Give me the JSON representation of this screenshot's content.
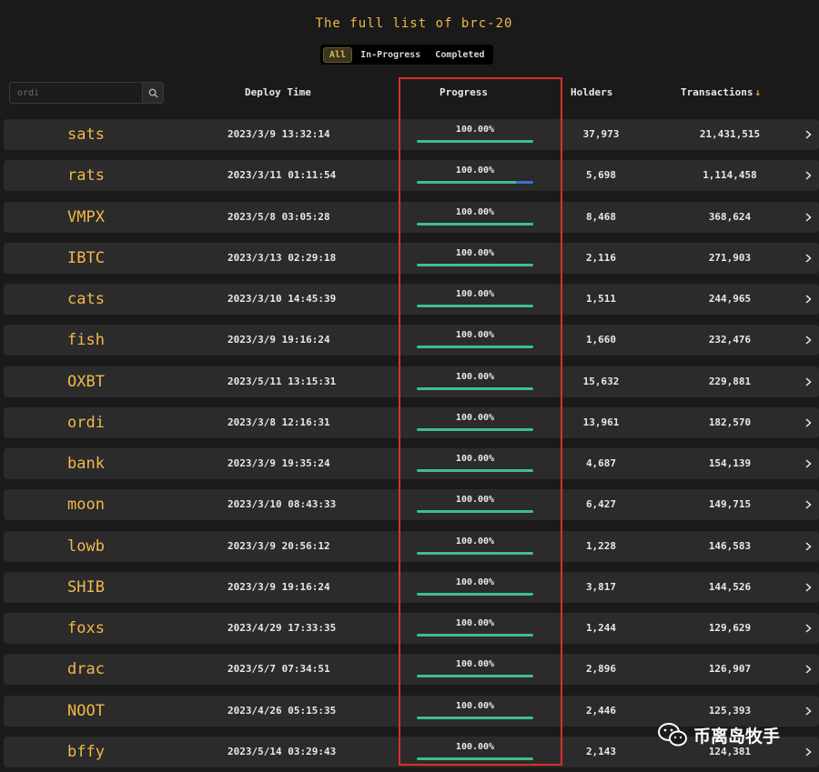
{
  "title": "The full list of brc-20",
  "tabs": [
    {
      "label": "All",
      "active": true
    },
    {
      "label": "In-Progress",
      "active": false
    },
    {
      "label": "Completed",
      "active": false
    }
  ],
  "search": {
    "placeholder": "ordi",
    "icon": "search-icon"
  },
  "columns": {
    "deploy_time": "Deploy Time",
    "progress": "Progress",
    "holders": "Holders",
    "transactions": "Transactions",
    "sort_indicator": "↓"
  },
  "colors": {
    "accent": "#f2b84b",
    "progress_fill": "#3fbf8a",
    "progress_track": "#3a6ed8",
    "highlight": "#d9302a"
  },
  "rows": [
    {
      "ticker": "sats",
      "deploy_time": "2023/3/9 13:32:14",
      "progress_label": "100.00%",
      "progress_fraction": 1.0,
      "holders": "37,973",
      "transactions": "21,431,515"
    },
    {
      "ticker": "rats",
      "deploy_time": "2023/3/11 01:11:54",
      "progress_label": "100.00%",
      "progress_fraction": 0.85,
      "holders": "5,698",
      "transactions": "1,114,458"
    },
    {
      "ticker": "VMPX",
      "deploy_time": "2023/5/8 03:05:28",
      "progress_label": "100.00%",
      "progress_fraction": 1.0,
      "holders": "8,468",
      "transactions": "368,624"
    },
    {
      "ticker": "IBTC",
      "deploy_time": "2023/3/13 02:29:18",
      "progress_label": "100.00%",
      "progress_fraction": 1.0,
      "holders": "2,116",
      "transactions": "271,903"
    },
    {
      "ticker": "cats",
      "deploy_time": "2023/3/10 14:45:39",
      "progress_label": "100.00%",
      "progress_fraction": 1.0,
      "holders": "1,511",
      "transactions": "244,965"
    },
    {
      "ticker": "fish",
      "deploy_time": "2023/3/9 19:16:24",
      "progress_label": "100.00%",
      "progress_fraction": 1.0,
      "holders": "1,660",
      "transactions": "232,476"
    },
    {
      "ticker": "OXBT",
      "deploy_time": "2023/5/11 13:15:31",
      "progress_label": "100.00%",
      "progress_fraction": 1.0,
      "holders": "15,632",
      "transactions": "229,881"
    },
    {
      "ticker": "ordi",
      "deploy_time": "2023/3/8 12:16:31",
      "progress_label": "100.00%",
      "progress_fraction": 1.0,
      "holders": "13,961",
      "transactions": "182,570"
    },
    {
      "ticker": "bank",
      "deploy_time": "2023/3/9 19:35:24",
      "progress_label": "100.00%",
      "progress_fraction": 1.0,
      "holders": "4,687",
      "transactions": "154,139"
    },
    {
      "ticker": "moon",
      "deploy_time": "2023/3/10 08:43:33",
      "progress_label": "100.00%",
      "progress_fraction": 1.0,
      "holders": "6,427",
      "transactions": "149,715"
    },
    {
      "ticker": "lowb",
      "deploy_time": "2023/3/9 20:56:12",
      "progress_label": "100.00%",
      "progress_fraction": 1.0,
      "holders": "1,228",
      "transactions": "146,583"
    },
    {
      "ticker": "SHIB",
      "deploy_time": "2023/3/9 19:16:24",
      "progress_label": "100.00%",
      "progress_fraction": 1.0,
      "holders": "3,817",
      "transactions": "144,526"
    },
    {
      "ticker": "foxs",
      "deploy_time": "2023/4/29 17:33:35",
      "progress_label": "100.00%",
      "progress_fraction": 1.0,
      "holders": "1,244",
      "transactions": "129,629"
    },
    {
      "ticker": "drac",
      "deploy_time": "2023/5/7 07:34:51",
      "progress_label": "100.00%",
      "progress_fraction": 1.0,
      "holders": "2,896",
      "transactions": "126,907"
    },
    {
      "ticker": "NOOT",
      "deploy_time": "2023/4/26 05:15:35",
      "progress_label": "100.00%",
      "progress_fraction": 1.0,
      "holders": "2,446",
      "transactions": "125,393"
    },
    {
      "ticker": "bffy",
      "deploy_time": "2023/5/14 03:29:43",
      "progress_label": "100.00%",
      "progress_fraction": 1.0,
      "holders": "2,143",
      "transactions": "124,381"
    }
  ],
  "watermark": {
    "text": "币离岛牧手",
    "icon": "wechat-icon"
  }
}
